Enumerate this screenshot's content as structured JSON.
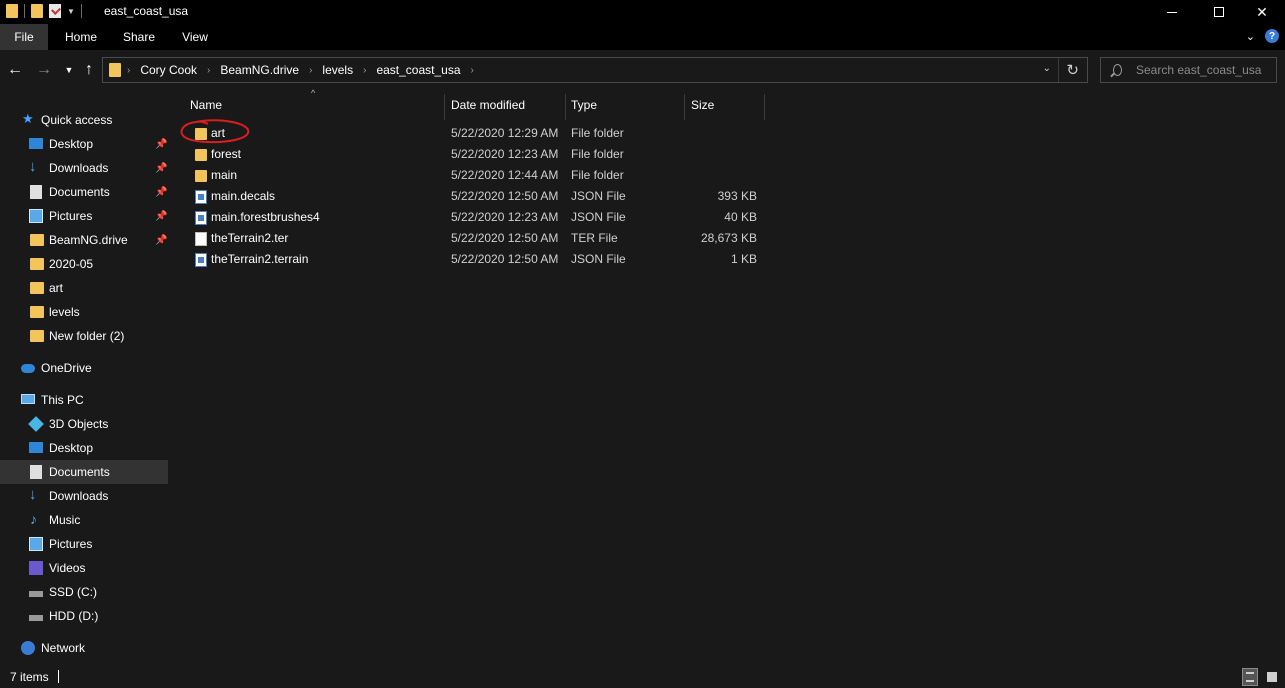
{
  "window": {
    "title": "east_coast_usa"
  },
  "ribbon": {
    "tabs": [
      {
        "label": "File"
      },
      {
        "label": "Home"
      },
      {
        "label": "Share"
      },
      {
        "label": "View"
      }
    ],
    "help": "?"
  },
  "address_bar": {
    "crumbs": [
      "Cory Cook",
      "BeamNG.drive",
      "levels",
      "east_coast_usa"
    ]
  },
  "search": {
    "placeholder": "Search east_coast_usa"
  },
  "sidebar": {
    "quick_access": "Quick access",
    "quick_items": [
      {
        "label": "Desktop",
        "icon": "desktop-icon",
        "pinned": true
      },
      {
        "label": "Downloads",
        "icon": "downloads-icon",
        "pinned": true
      },
      {
        "label": "Documents",
        "icon": "documents-icon",
        "pinned": true
      },
      {
        "label": "Pictures",
        "icon": "pictures-icon",
        "pinned": true
      },
      {
        "label": "BeamNG.drive",
        "icon": "folder-icon",
        "pinned": true
      },
      {
        "label": "2020-05",
        "icon": "folder-icon",
        "pinned": false
      },
      {
        "label": "art",
        "icon": "folder-icon",
        "pinned": false
      },
      {
        "label": "levels",
        "icon": "folder-icon",
        "pinned": false
      },
      {
        "label": "New folder (2)",
        "icon": "folder-icon",
        "pinned": false
      }
    ],
    "onedrive": "OneDrive",
    "this_pc": "This PC",
    "pc_items": [
      {
        "label": "3D Objects",
        "icon": "3d-objects-icon"
      },
      {
        "label": "Desktop",
        "icon": "desktop-icon"
      },
      {
        "label": "Documents",
        "icon": "documents-icon",
        "selected": true
      },
      {
        "label": "Downloads",
        "icon": "downloads-icon"
      },
      {
        "label": "Music",
        "icon": "music-icon"
      },
      {
        "label": "Pictures",
        "icon": "pictures-icon"
      },
      {
        "label": "Videos",
        "icon": "videos-icon"
      },
      {
        "label": "SSD (C:)",
        "icon": "drive-icon"
      },
      {
        "label": "HDD (D:)",
        "icon": "drive-icon"
      }
    ],
    "network": "Network"
  },
  "columns": {
    "name": "Name",
    "date": "Date modified",
    "type": "Type",
    "size": "Size"
  },
  "files": [
    {
      "name": "art",
      "date": "5/22/2020 12:29 AM",
      "type": "File folder",
      "size": "",
      "icon": "folder-icon",
      "annotated": true
    },
    {
      "name": "forest",
      "date": "5/22/2020 12:23 AM",
      "type": "File folder",
      "size": "",
      "icon": "folder-icon"
    },
    {
      "name": "main",
      "date": "5/22/2020 12:44 AM",
      "type": "File folder",
      "size": "",
      "icon": "folder-icon"
    },
    {
      "name": "main.decals",
      "date": "5/22/2020 12:50 AM",
      "type": "JSON File",
      "size": "393 KB",
      "icon": "json-file-icon"
    },
    {
      "name": "main.forestbrushes4",
      "date": "5/22/2020 12:23 AM",
      "type": "JSON File",
      "size": "40 KB",
      "icon": "json-file-icon"
    },
    {
      "name": "theTerrain2.ter",
      "date": "5/22/2020 12:50 AM",
      "type": "TER File",
      "size": "28,673 KB",
      "icon": "blank-file-icon"
    },
    {
      "name": "theTerrain2.terrain",
      "date": "5/22/2020 12:50 AM",
      "type": "JSON File",
      "size": "1 KB",
      "icon": "json-file-icon"
    }
  ],
  "status": {
    "count": "7 items"
  },
  "colors": {
    "annotation": "#d81e1e",
    "folder": "#f2c55c",
    "background": "#191919"
  }
}
